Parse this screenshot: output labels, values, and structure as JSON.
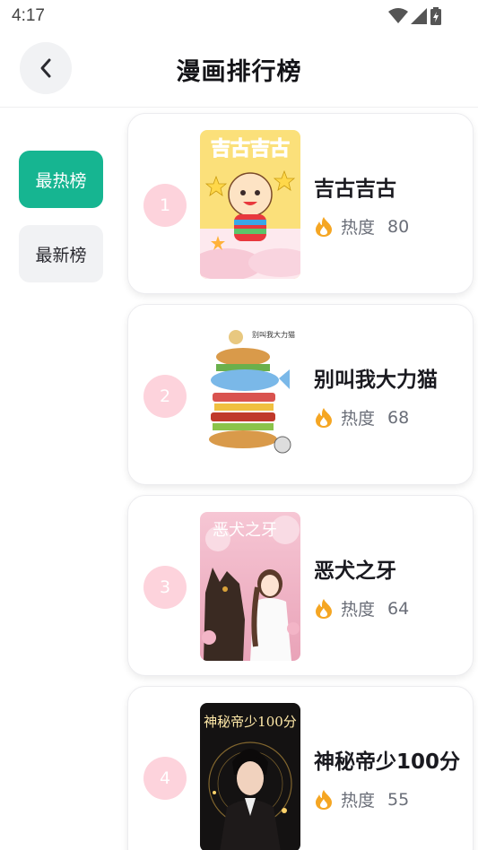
{
  "status_bar": {
    "time": "4:17"
  },
  "header": {
    "title": "漫画排行榜",
    "back_icon": "chevron-left-icon"
  },
  "sidebar": {
    "tabs": [
      {
        "label": "最热榜",
        "active": true
      },
      {
        "label": "最新榜",
        "active": false
      }
    ]
  },
  "ranking": {
    "heat_label": "热度",
    "items": [
      {
        "rank": "1",
        "title": "吉古吉古",
        "heat": "80",
        "cover_text": "吉古吉古"
      },
      {
        "rank": "2",
        "title": "别叫我大力猫",
        "heat": "68",
        "cover_text": "别叫我大力猫"
      },
      {
        "rank": "3",
        "title": "恶犬之牙",
        "heat": "64",
        "cover_text": "恶犬之牙"
      },
      {
        "rank": "4",
        "title": "神秘帝少100分",
        "heat": "55",
        "cover_text": "神秘帝少100分"
      }
    ]
  },
  "colors": {
    "accent": "#16b591",
    "rank_badge": "#fdd3dc",
    "flame": "#f5a623"
  }
}
